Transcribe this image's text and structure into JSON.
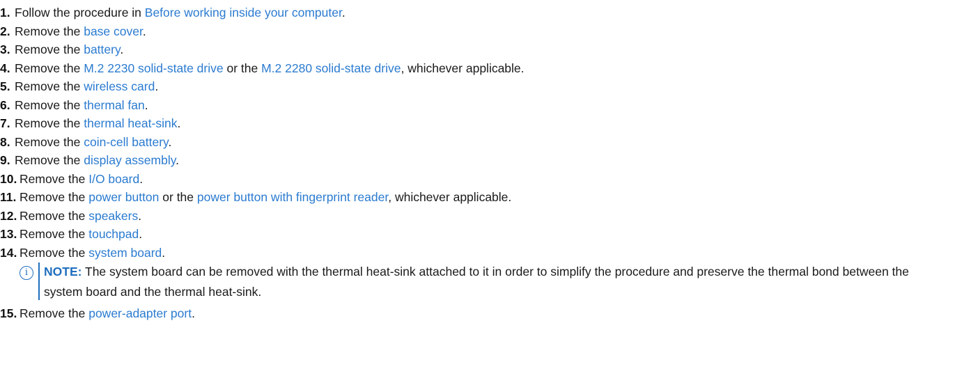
{
  "steps": [
    {
      "num": "1.",
      "parts": [
        {
          "t": "Follow the procedure in "
        },
        {
          "t": "Before working inside your computer",
          "link": true
        },
        {
          "t": "."
        }
      ]
    },
    {
      "num": "2.",
      "parts": [
        {
          "t": "Remove the "
        },
        {
          "t": "base cover",
          "link": true
        },
        {
          "t": "."
        }
      ]
    },
    {
      "num": "3.",
      "parts": [
        {
          "t": "Remove the "
        },
        {
          "t": "battery",
          "link": true
        },
        {
          "t": "."
        }
      ]
    },
    {
      "num": "4.",
      "parts": [
        {
          "t": "Remove the "
        },
        {
          "t": "M.2 2230 solid-state drive",
          "link": true
        },
        {
          "t": " or the "
        },
        {
          "t": "M.2 2280 solid-state drive",
          "link": true
        },
        {
          "t": ", whichever applicable."
        }
      ]
    },
    {
      "num": "5.",
      "parts": [
        {
          "t": "Remove the "
        },
        {
          "t": "wireless card",
          "link": true
        },
        {
          "t": "."
        }
      ]
    },
    {
      "num": "6.",
      "parts": [
        {
          "t": "Remove the "
        },
        {
          "t": "thermal fan",
          "link": true
        },
        {
          "t": "."
        }
      ]
    },
    {
      "num": "7.",
      "parts": [
        {
          "t": "Remove the "
        },
        {
          "t": "thermal heat-sink",
          "link": true
        },
        {
          "t": "."
        }
      ]
    },
    {
      "num": "8.",
      "parts": [
        {
          "t": "Remove the "
        },
        {
          "t": "coin-cell battery",
          "link": true
        },
        {
          "t": "."
        }
      ]
    },
    {
      "num": "9.",
      "parts": [
        {
          "t": "Remove the "
        },
        {
          "t": "display assembly",
          "link": true
        },
        {
          "t": "."
        }
      ]
    },
    {
      "num": "10.",
      "parts": [
        {
          "t": "Remove the "
        },
        {
          "t": "I/O board",
          "link": true
        },
        {
          "t": "."
        }
      ]
    },
    {
      "num": "11.",
      "parts": [
        {
          "t": "Remove the "
        },
        {
          "t": "power button",
          "link": true
        },
        {
          "t": " or the "
        },
        {
          "t": "power button with fingerprint reader",
          "link": true
        },
        {
          "t": ", whichever applicable."
        }
      ]
    },
    {
      "num": "12.",
      "parts": [
        {
          "t": "Remove the "
        },
        {
          "t": "speakers",
          "link": true
        },
        {
          "t": "."
        }
      ]
    },
    {
      "num": "13.",
      "parts": [
        {
          "t": "Remove the "
        },
        {
          "t": "touchpad",
          "link": true
        },
        {
          "t": "."
        }
      ]
    },
    {
      "num": "14.",
      "parts": [
        {
          "t": "Remove the "
        },
        {
          "t": "system board",
          "link": true
        },
        {
          "t": "."
        }
      ]
    },
    {
      "num": "15.",
      "parts": [
        {
          "t": "Remove the "
        },
        {
          "t": "power-adapter port",
          "link": true
        },
        {
          "t": "."
        }
      ]
    }
  ],
  "note": {
    "icon": "info-icon",
    "icon_glyph": "i",
    "label": "NOTE:",
    "text": " The system board can be removed with the thermal heat-sink attached to it in order to simplify the procedure and preserve the thermal bond between the system board and the thermal heat-sink."
  },
  "colors": {
    "link": "#2b7bd0",
    "note_accent": "#1f6fbf",
    "text": "#1a1a1a"
  }
}
